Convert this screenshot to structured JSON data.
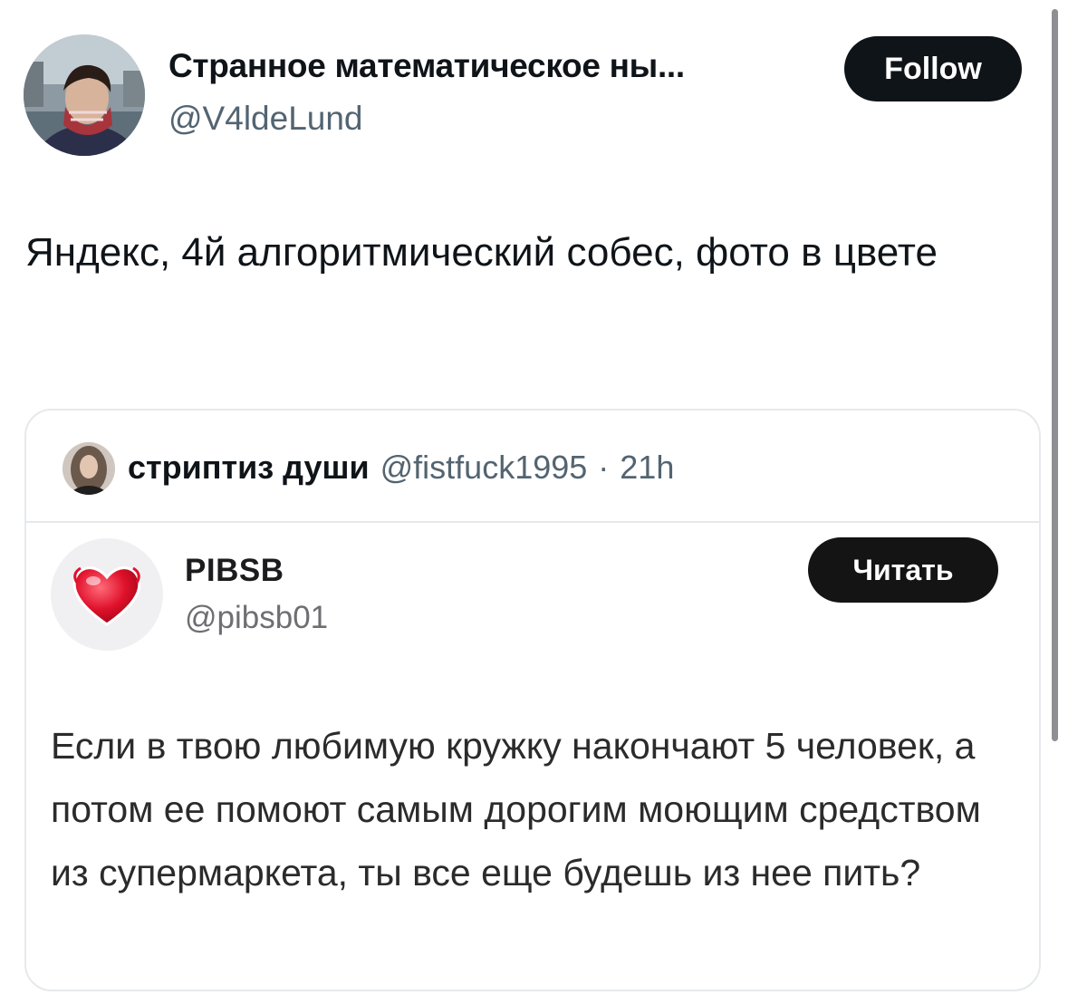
{
  "author": {
    "display_name": "Странное математическое ны...",
    "handle": "@V4ldeLund",
    "follow_label": "Follow"
  },
  "tweet": {
    "text": "Яндекс, 4й алгоритмический собес, фото в цвете"
  },
  "quoted": {
    "display_name": "стриптиз души",
    "handle": "@fistfuck1995",
    "separator": "·",
    "time": "21h",
    "screenshot": {
      "name": "PIBSB",
      "handle": "@pibsb01",
      "read_label": "Читать",
      "text": "Если в твою любимую кружку накончают 5 человек, а потом ее помоют самым дорогим моющим средством из супермаркета, ты все еще будешь из нее пить?"
    }
  },
  "colors": {
    "text_primary": "#0f1419",
    "text_secondary": "#536471",
    "button_bg": "#0f1419",
    "border": "#e6e9ec",
    "heart": "#e0112b"
  }
}
